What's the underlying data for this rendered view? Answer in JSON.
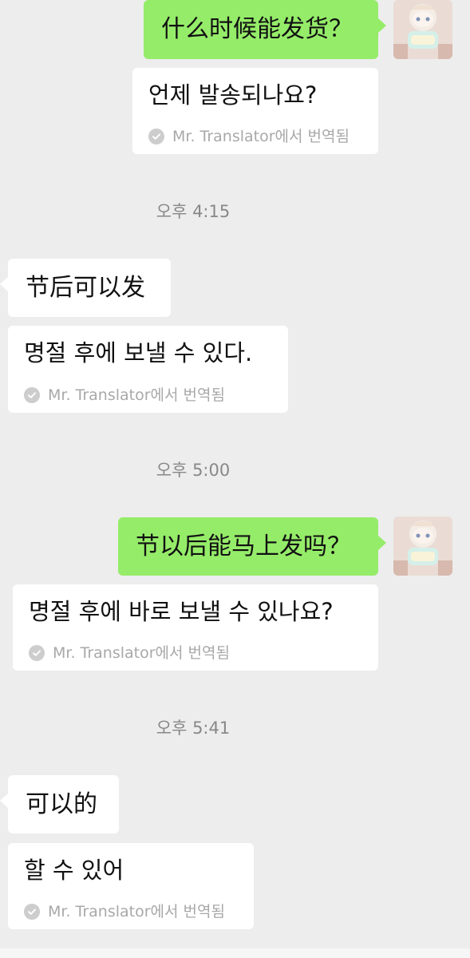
{
  "messages": {
    "m1": {
      "text": "什么时候能发货？"
    },
    "t1": {
      "text": "언제 발송되나요?",
      "note": "Mr. Translator에서 번역됨"
    },
    "time1": {
      "text": "오후 4:15"
    },
    "m2": {
      "text": "节后可以发"
    },
    "t2": {
      "text": "명절 후에 보낼 수 있다.",
      "note": "Mr. Translator에서 번역됨"
    },
    "time2": {
      "text": "오후 5:00"
    },
    "m3": {
      "text": "节以后能马上发吗？"
    },
    "t3": {
      "text": "명절 후에 바로 보낼 수 있나요?",
      "note": "Mr. Translator에서 번역됨"
    },
    "time3": {
      "text": "오후 5:41"
    },
    "m4": {
      "text": "可以的"
    },
    "t4": {
      "text": "할 수 있어",
      "note": "Mr. Translator에서 번역됨"
    }
  },
  "colors": {
    "background": "#ededed",
    "outgoing_bubble": "#95ec69",
    "incoming_bubble": "#ffffff",
    "timestamp": "#888888",
    "translation_note": "#a8a8a8"
  },
  "icons": {
    "translation_status": "check-circle-icon",
    "avatar": "user-avatar-doll"
  }
}
